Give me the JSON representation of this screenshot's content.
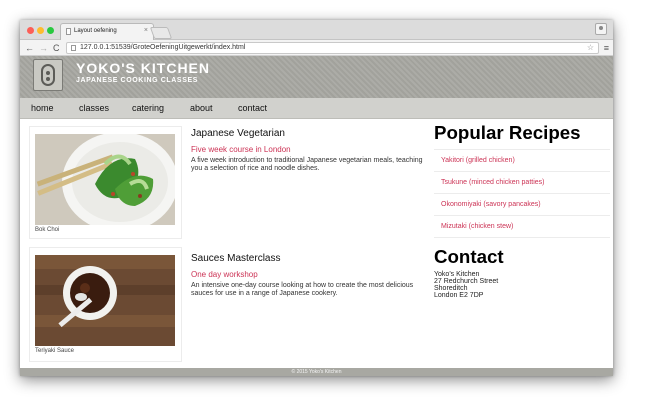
{
  "browser": {
    "tab_title": "Layout oefening",
    "tab_close": "×",
    "url": "127.0.0.1:51539/GroteOefeningUitgewerkt/index.html",
    "back_icon": "←",
    "forward_icon": "→",
    "reload_icon": "C",
    "star_icon": "☆",
    "menu_icon": "≡"
  },
  "site": {
    "title": "YOKO'S KITCHEN",
    "subtitle": "JAPANESE COOKING CLASSES"
  },
  "nav": {
    "items": [
      {
        "label": "home"
      },
      {
        "label": "classes"
      },
      {
        "label": "catering"
      },
      {
        "label": "about"
      },
      {
        "label": "contact"
      }
    ]
  },
  "articles": [
    {
      "image_caption": "Bok Choi",
      "title": "Japanese Vegetarian",
      "subtitle": "Five week course in London",
      "description": "A five week introduction to traditional Japanese vegetarian meals, teaching you a selection of rice and noodle dishes."
    },
    {
      "image_caption": "Teriyaki Sauce",
      "title": "Sauces Masterclass",
      "subtitle": "One day workshop",
      "description": "An intensive one-day course looking at how to create the most delicious sauces for use in a range of Japanese cookery."
    }
  ],
  "popular": {
    "heading": "Popular Recipes",
    "items": [
      {
        "label": "Yakitori (grilled chicken)"
      },
      {
        "label": "Tsukune (minced chicken patties)"
      },
      {
        "label": "Okonomiyaki (savory pancakes)"
      },
      {
        "label": "Mizutaki (chicken stew)"
      }
    ]
  },
  "contact": {
    "heading": "Contact",
    "lines": [
      "Yoko's Kitchen",
      "27 Redchurch Street",
      "Shoreditch",
      "London E2 7DP"
    ]
  },
  "footer": {
    "text": "© 2015 Yoko's Kitchen"
  },
  "colors": {
    "accent_link": "#cc3355",
    "header_bg": "#a8a8a2",
    "nav_bg": "#d1d1cd"
  }
}
